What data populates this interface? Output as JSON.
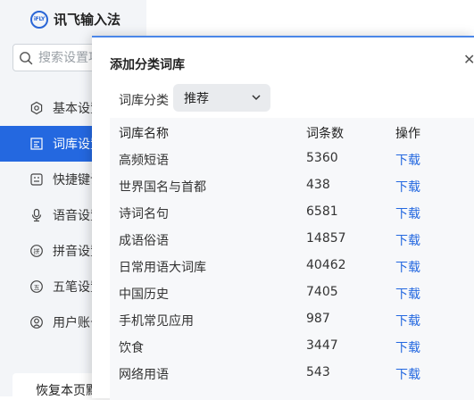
{
  "sidebar": {
    "brand": {
      "logo_text": "iFLY",
      "name": "讯飞输入法"
    },
    "search": {
      "placeholder": "搜索设置项"
    },
    "items": [
      {
        "label": "基本设置",
        "icon": "settings-icon"
      },
      {
        "label": "词库设置",
        "icon": "dictionary-icon",
        "active": true
      },
      {
        "label": "快捷键设置",
        "icon": "keyboard-icon"
      },
      {
        "label": "语音设置",
        "icon": "microphone-icon"
      },
      {
        "label": "拼音设置",
        "icon": "pinyin-icon"
      },
      {
        "label": "五笔设置",
        "icon": "wubi-icon"
      },
      {
        "label": "用户账号",
        "icon": "user-icon"
      }
    ],
    "restore_label": "恢复本页默认"
  },
  "dialog": {
    "title": "添加分类词库",
    "close_icon": "close-icon",
    "category": {
      "label": "词库分类",
      "selected": "推荐"
    },
    "table": {
      "headers": [
        "词库名称",
        "词条数",
        "操作"
      ],
      "rows": [
        {
          "name": "高频短语",
          "count": "5360",
          "action": "下载"
        },
        {
          "name": "世界国名与首都",
          "count": "438",
          "action": "下载"
        },
        {
          "name": "诗词名句",
          "count": "6581",
          "action": "下载"
        },
        {
          "name": "成语俗语",
          "count": "14857",
          "action": "下载"
        },
        {
          "name": "日常用语大词库",
          "count": "40462",
          "action": "下载"
        },
        {
          "name": "中国历史",
          "count": "7405",
          "action": "下载"
        },
        {
          "name": "手机常见应用",
          "count": "987",
          "action": "下载"
        },
        {
          "name": "饮食",
          "count": "3447",
          "action": "下载"
        },
        {
          "name": "网络用语",
          "count": "543",
          "action": "下载"
        }
      ]
    }
  },
  "colors": {
    "accent": "#2468e0",
    "sidebar_bg": "#f3f5f8",
    "table_bg": "#f7f8fa"
  }
}
